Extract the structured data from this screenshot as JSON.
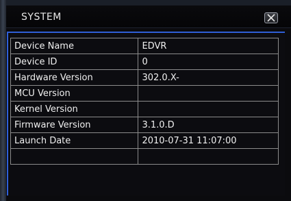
{
  "window": {
    "title": "SYSTEM",
    "accent_color": "#2f5fd8",
    "close_icon": "close-icon"
  },
  "info_table": {
    "rows": [
      {
        "label": "Device Name",
        "value": "EDVR"
      },
      {
        "label": "Device ID",
        "value": "0"
      },
      {
        "label": "Hardware Version",
        "value": "302.0.X-"
      },
      {
        "label": "MCU Version",
        "value": ""
      },
      {
        "label": "Kernel Version",
        "value": ""
      },
      {
        "label": "Firmware Version",
        "value": "3.1.0.D"
      },
      {
        "label": "Launch Date",
        "value": "2010-07-31 11:07:00"
      },
      {
        "label": "",
        "value": ""
      }
    ]
  }
}
